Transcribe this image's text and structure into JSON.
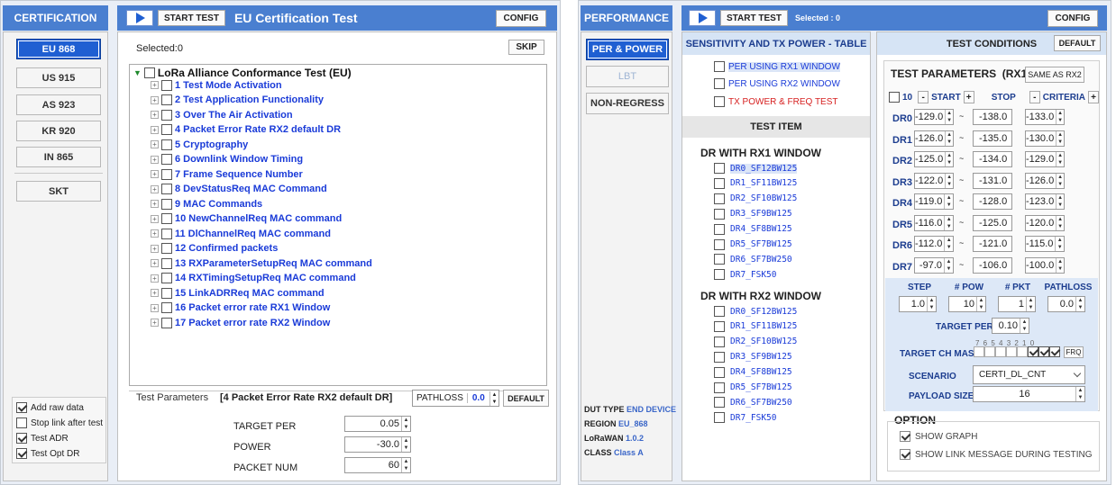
{
  "left": {
    "sidebar": {
      "header": "CERTIFICATION",
      "regions": [
        "EU 868",
        "US 915",
        "AS 923",
        "KR 920",
        "IN 865",
        "SKT"
      ],
      "options": [
        {
          "label": "Add raw data",
          "checked": true
        },
        {
          "label": "Stop link after test",
          "checked": false
        },
        {
          "label": "Test ADR",
          "checked": true
        },
        {
          "label": "Test Opt DR",
          "checked": true
        }
      ]
    },
    "toolbar": {
      "start": "START TEST",
      "title": "EU Certification Test",
      "config": "CONFIG"
    },
    "selected": "Selected:0",
    "skip": "SKIP",
    "tree": {
      "root": "LoRa Alliance Conformance Test (EU)",
      "items": [
        "1 Test Mode Activation",
        "2 Test Application Functionality",
        "3 Over The Air Activation",
        "4 Packet Error Rate RX2 default DR",
        "5 Cryptography",
        "6 Downlink Window Timing",
        "7 Frame Sequence Number",
        "8 DevStatusReq MAC Command",
        "9 MAC Commands",
        "10 NewChannelReq MAC command",
        "11 DlChannelReq MAC command",
        "12 Confirmed packets",
        "13 RXParameterSetupReq MAC command",
        "14 RXTimingSetupReq MAC command",
        "15 LinkADRReq MAC command",
        "16 Packet error rate RX1 Window",
        "17 Packet error rate RX2 Window"
      ]
    },
    "params": {
      "label": "Test Parameters",
      "context": "[4 Packet Error Rate RX2 default DR]",
      "pathloss_label": "PATHLOSS",
      "pathloss": "0.0",
      "default": "DEFAULT",
      "rows": [
        {
          "label": "TARGET PER",
          "value": "0.05"
        },
        {
          "label": "POWER",
          "value": "-30.0"
        },
        {
          "label": "PACKET NUM",
          "value": "60"
        }
      ]
    }
  },
  "right": {
    "sidebar": {
      "header": "PERFORMANCE",
      "tabs": [
        "PER & POWER",
        "LBT",
        "NON-REGRESS"
      ],
      "info": [
        {
          "k": "DUT TYPE",
          "v": "END DEVICE"
        },
        {
          "k": "REGION",
          "v": "EU_868"
        },
        {
          "k": "LoRaWAN",
          "v": "1.0.2"
        },
        {
          "k": "CLASS",
          "v": "Class A"
        }
      ]
    },
    "toolbar": {
      "start": "START TEST",
      "selected": "Selected : 0",
      "config": "CONFIG"
    },
    "table": {
      "header": "SENSITIVITY AND TX POWER - TABLE",
      "modes": [
        {
          "label": "PER USING RX1 WINDOW",
          "color": "#1a3bd8"
        },
        {
          "label": "PER USING RX2 WINDOW",
          "color": "#1a3bd8"
        },
        {
          "label": "TX POWER & FREQ TEST",
          "color": "#d62020"
        }
      ],
      "item_header": "TEST ITEM",
      "rx1_title": "DR WITH RX1 WINDOW",
      "rx1": [
        "DR0_SF12BW125",
        "DR1_SF11BW125",
        "DR2_SF10BW125",
        "DR3_SF9BW125",
        "DR4_SF8BW125",
        "DR5_SF7BW125",
        "DR6_SF7BW250",
        "DR7_FSK50"
      ],
      "rx2_title": "DR WITH RX2 WINDOW",
      "rx2": [
        "DR0_SF12BW125",
        "DR1_SF11BW125",
        "DR2_SF10BW125",
        "DR3_SF9BW125",
        "DR4_SF8BW125",
        "DR5_SF7BW125",
        "DR6_SF7BW250",
        "DR7_FSK50"
      ]
    },
    "conditions": {
      "header": "TEST CONDITIONS",
      "default": "DEFAULT",
      "params_title": "TEST PARAMETERS",
      "rx": "(RX1)",
      "same": "SAME AS RX2",
      "cols": {
        "count": "10",
        "start": "START",
        "stop": "STOP",
        "criteria": "CRITERIA"
      },
      "rows": [
        {
          "dr": "DR0",
          "start": "-129.0",
          "stop": "-138.0",
          "crit": "-133.0"
        },
        {
          "dr": "DR1",
          "start": "-126.0",
          "stop": "-135.0",
          "crit": "-130.0"
        },
        {
          "dr": "DR2",
          "start": "-125.0",
          "stop": "-134.0",
          "crit": "-129.0"
        },
        {
          "dr": "DR3",
          "start": "-122.0",
          "stop": "-131.0",
          "crit": "-126.0"
        },
        {
          "dr": "DR4",
          "start": "-119.0",
          "stop": "-128.0",
          "crit": "-123.0"
        },
        {
          "dr": "DR5",
          "start": "-116.0",
          "stop": "-125.0",
          "crit": "-120.0"
        },
        {
          "dr": "DR6",
          "start": "-112.0",
          "stop": "-121.0",
          "crit": "-115.0"
        },
        {
          "dr": "DR7",
          "start": "-97.0",
          "stop": "-106.0",
          "crit": "-100.0"
        }
      ],
      "step_labels": [
        "STEP",
        "# POW",
        "# PKT",
        "PATHLOSS"
      ],
      "step_values": [
        "1.0",
        "10",
        "1",
        "0.0"
      ],
      "target_per_label": "TARGET PER",
      "target_per": "0.10",
      "mask_label": "TARGET CH MASK",
      "mask_bits": "7 6 5 4 3 2 1 0",
      "frq": "FRQ",
      "scenario_label": "SCENARIO",
      "scenario": "CERTI_DL_CNT",
      "payload_label": "PAYLOAD SIZE",
      "payload": "16",
      "option_title": "OPTION",
      "options": [
        "SHOW GRAPH",
        "SHOW LINK MESSAGE DURING TESTING"
      ]
    }
  }
}
